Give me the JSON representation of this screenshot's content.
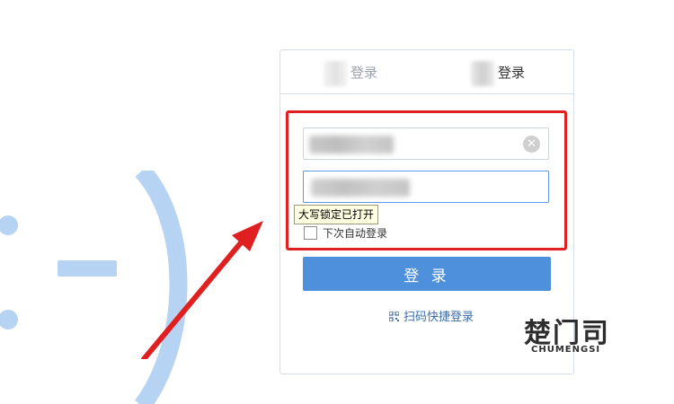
{
  "tabs": [
    {
      "label": "登录"
    },
    {
      "label": "登录"
    }
  ],
  "caps_lock_tooltip": "大写锁定已打开",
  "remember_label": "下次自动登录",
  "login_button_label": "登 录",
  "qr_login_label": "扫码快捷登录",
  "clear_icon_glyph": "✕",
  "watermark": {
    "main": "楚门司",
    "sub": "CHUMENGSI"
  },
  "colors": {
    "accent": "#4e90dc",
    "annotation_red": "#e02020",
    "emoticon": "#b7d3f3"
  },
  "icons": [
    "clear-icon",
    "qr-code-icon",
    "checkbox-icon"
  ]
}
